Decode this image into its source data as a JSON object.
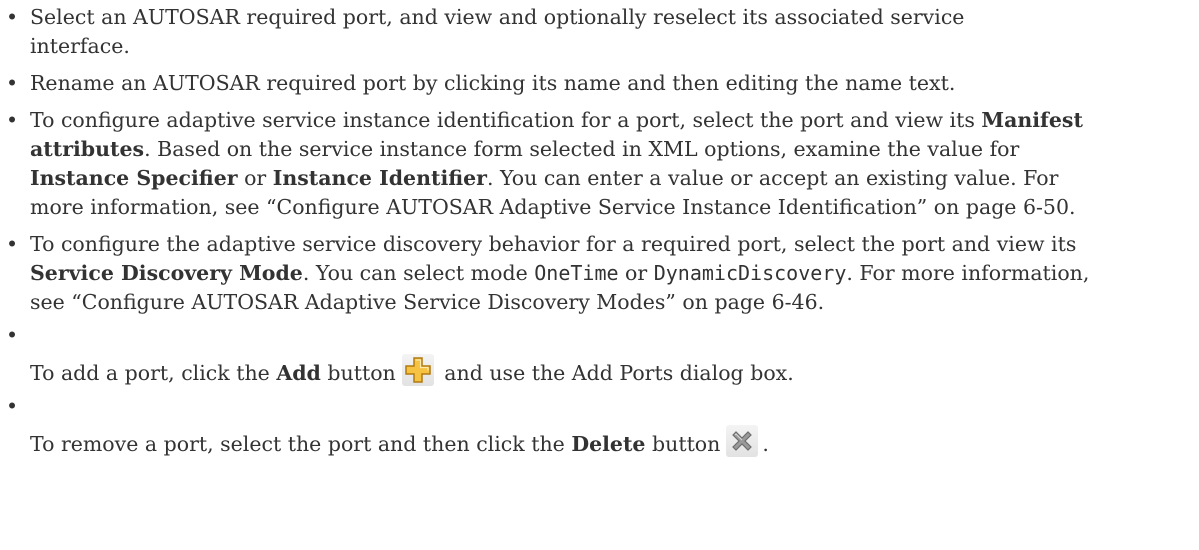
{
  "bullets": {
    "b1": {
      "text": "Select an AUTOSAR required port, and view and optionally reselect its associated service interface."
    },
    "b2": {
      "text": "Rename an AUTOSAR required port by clicking its name and then editing the name text."
    },
    "b3": {
      "t1": "To configure adaptive service instance identification for a port, select the port and view its ",
      "bold1": "Manifest attributes",
      "t2": ". Based on the service instance form selected in XML options, examine the value for ",
      "bold2": "Instance Specifier",
      "t3": " or ",
      "bold3": "Instance Identifier",
      "t4": ". You can enter a value or accept an existing value. For more information, see “Configure AUTOSAR Adaptive Service Instance Identification” on page 6-50."
    },
    "b4": {
      "t1": "To configure the adaptive service discovery behavior for a required port, select the port and view its ",
      "bold1": "Service Discovery Mode",
      "t2": ". You can select mode ",
      "code1": "OneTime",
      "t3": " or ",
      "code2": "DynamicDiscovery",
      "t4": ". For more information, see “Configure AUTOSAR Adaptive Service Discovery Modes” on page 6-46."
    },
    "b5": {
      "t1": "To add a port, click the ",
      "bold1": "Add",
      "t2": " button",
      "t3": " and use the Add Ports dialog box.",
      "icon": "add-plus-icon"
    },
    "b6": {
      "t1": "To remove a port, select the port and then click the ",
      "bold1": "Delete",
      "t2": " button",
      "t3": ".",
      "icon": "delete-x-icon"
    }
  },
  "bullet_char": "•",
  "colors": {
    "text": "#333333",
    "add_icon_fill": "#f5c242",
    "delete_icon_fill": "#9a9a9a"
  }
}
